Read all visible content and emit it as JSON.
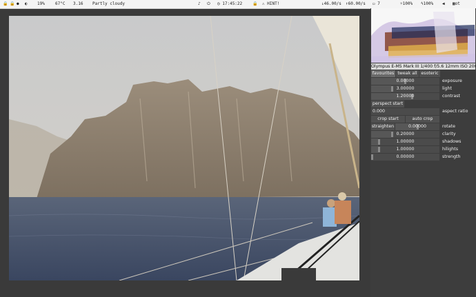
{
  "statusbar": {
    "battery_pct": "19%",
    "temperature": "67°C",
    "load": "3.16",
    "weather": "Partly cloudy",
    "clock": "17:45:22",
    "hint": "HINT!",
    "net_down": "46.00/s",
    "net_up": "60.00/s",
    "count": "7",
    "brightness": "100%",
    "battery2": "100%",
    "app": "ot"
  },
  "panel": {
    "camera_info": "Olympus E-M5 Mark III 1/400 f/5.6 12mm ISO 200",
    "tabs": [
      "favourites",
      "tweak all",
      "esoteric"
    ],
    "controls": {
      "exposure": {
        "value": "0.00000",
        "label": "exposure",
        "level": 0.5
      },
      "light": {
        "value": "3.00000",
        "label": "light",
        "level": 0.3
      },
      "contrast": {
        "value": "1.20000",
        "label": "contrast",
        "level": 0.6
      }
    },
    "perspect_start": "perspect start",
    "aspect": {
      "value": "0.000",
      "label": "aspect ratio"
    },
    "crop_start": "crop start",
    "auto_crop": "auto crop",
    "straighten": "straighten",
    "rotate": {
      "value": "0.00000",
      "label": "rotate",
      "level": 0.5
    },
    "clarity": {
      "value": "0.20000",
      "label": "clarity",
      "level": 0.3
    },
    "shadows": {
      "value": "1.00000",
      "label": "shadows",
      "level": 0.1
    },
    "hilights": {
      "value": "1.00000",
      "label": "hilights",
      "level": 0.1
    },
    "strength": {
      "value": "0.00000",
      "label": "strength",
      "level": 0.0
    }
  }
}
